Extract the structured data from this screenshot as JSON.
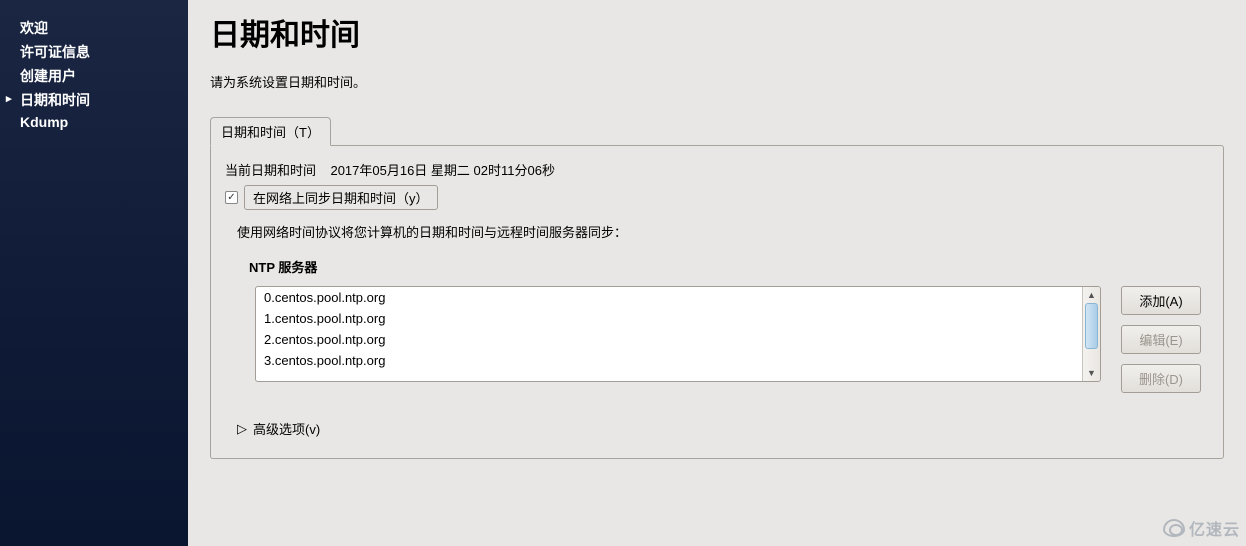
{
  "sidebar": {
    "items": [
      {
        "label": "欢迎",
        "active": false
      },
      {
        "label": "许可证信息",
        "active": false
      },
      {
        "label": "创建用户",
        "active": false
      },
      {
        "label": "日期和时间",
        "active": true
      },
      {
        "label": "Kdump",
        "active": false
      }
    ]
  },
  "page": {
    "title": "日期和时间",
    "desc": "请为系统设置日期和时间。"
  },
  "tab": {
    "label": "日期和时间（T）"
  },
  "current": {
    "label": "当前日期和时间",
    "value": "2017年05月16日  星期二  02时11分06秒"
  },
  "sync": {
    "checked": true,
    "label": "在网络上同步日期和时间（y）"
  },
  "ntp": {
    "desc": "使用网络时间协议将您计算机的日期和时间与远程时间服务器同步：",
    "title": "NTP 服务器",
    "servers": [
      "0.centos.pool.ntp.org",
      "1.centos.pool.ntp.org",
      "2.centos.pool.ntp.org",
      "3.centos.pool.ntp.org"
    ]
  },
  "buttons": {
    "add": "添加(A)",
    "edit": "编辑(E)",
    "del": "删除(D)"
  },
  "advanced": {
    "label": "高级选项(v)"
  },
  "watermark": {
    "text": "亿速云"
  }
}
